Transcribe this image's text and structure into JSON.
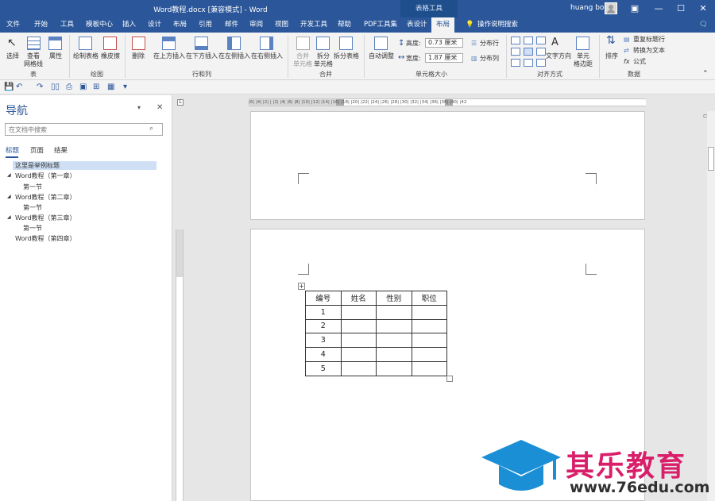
{
  "window": {
    "title": "Word教程.docx [兼容模式] - Word",
    "context_tab": "表格工具",
    "user": "huang bo"
  },
  "tabs": [
    "文件",
    "开始",
    "工具",
    "模板中心",
    "插入",
    "设计",
    "布局",
    "引用",
    "邮件",
    "审阅",
    "视图",
    "开发工具",
    "帮助",
    "PDF工具集",
    "表设计",
    "布局"
  ],
  "tell_me": "操作说明搜索",
  "ribbon": {
    "select": "选择",
    "gridlines": "查看\n网格线",
    "properties": "属性",
    "draw_table": "绘制表格",
    "eraser": "橡皮擦",
    "delete": "删除",
    "insert_above": "在上方插入",
    "insert_below": "在下方插入",
    "insert_left": "在左侧插入",
    "insert_right": "在右侧插入",
    "merge_cells": "合并\n单元格",
    "split_cells": "拆分\n单元格",
    "split_table": "拆分表格",
    "autofit": "自动调整",
    "height_label": "高度:",
    "height_value": "0.73 厘米",
    "width_label": "宽度:",
    "width_value": "1.87 厘米",
    "distribute_rows": "分布行",
    "distribute_cols": "分布列",
    "text_direction": "文字方向",
    "cell_margins": "单元\n格边距",
    "sort": "排序",
    "repeat_header": "重复标题行",
    "convert_text": "转换为文本",
    "formula": "公式",
    "groups": {
      "table": "表",
      "draw": "绘图",
      "rows_cols": "行和列",
      "merge": "合并",
      "cell_size": "单元格大小",
      "alignment": "对齐方式",
      "data": "数据"
    }
  },
  "nav": {
    "title": "导航",
    "search_placeholder": "在文档中搜索",
    "tabs": [
      "标题",
      "页面",
      "结果"
    ],
    "items": [
      "这里是举例标题",
      "Word教程（第一章）",
      "第一节",
      "Word教程（第二章）",
      "第一节",
      "Word教程（第三章）",
      "第一节",
      "Word教程（第四章）"
    ]
  },
  "ruler": {
    "marks": "|6| |4| |2| | |2| |4| |6| |8| |10| |12| |14| |16| |18| |20| |22| |24| |26| |28| |30| |32| |34| |36| |38| |40| |42"
  },
  "table": {
    "headers": [
      "编号",
      "姓名",
      "性别",
      "职位"
    ],
    "rows": [
      [
        "1",
        "",
        "",
        ""
      ],
      [
        "2",
        "",
        "",
        ""
      ],
      [
        "3",
        "",
        "",
        ""
      ],
      [
        "4",
        "",
        "",
        ""
      ],
      [
        "5",
        "",
        "",
        ""
      ]
    ]
  },
  "watermark": {
    "text": "其乐教育",
    "url": "www.76edu.com"
  },
  "colors": {
    "brand": "#2b579a",
    "watermark": "#d91e6a"
  }
}
